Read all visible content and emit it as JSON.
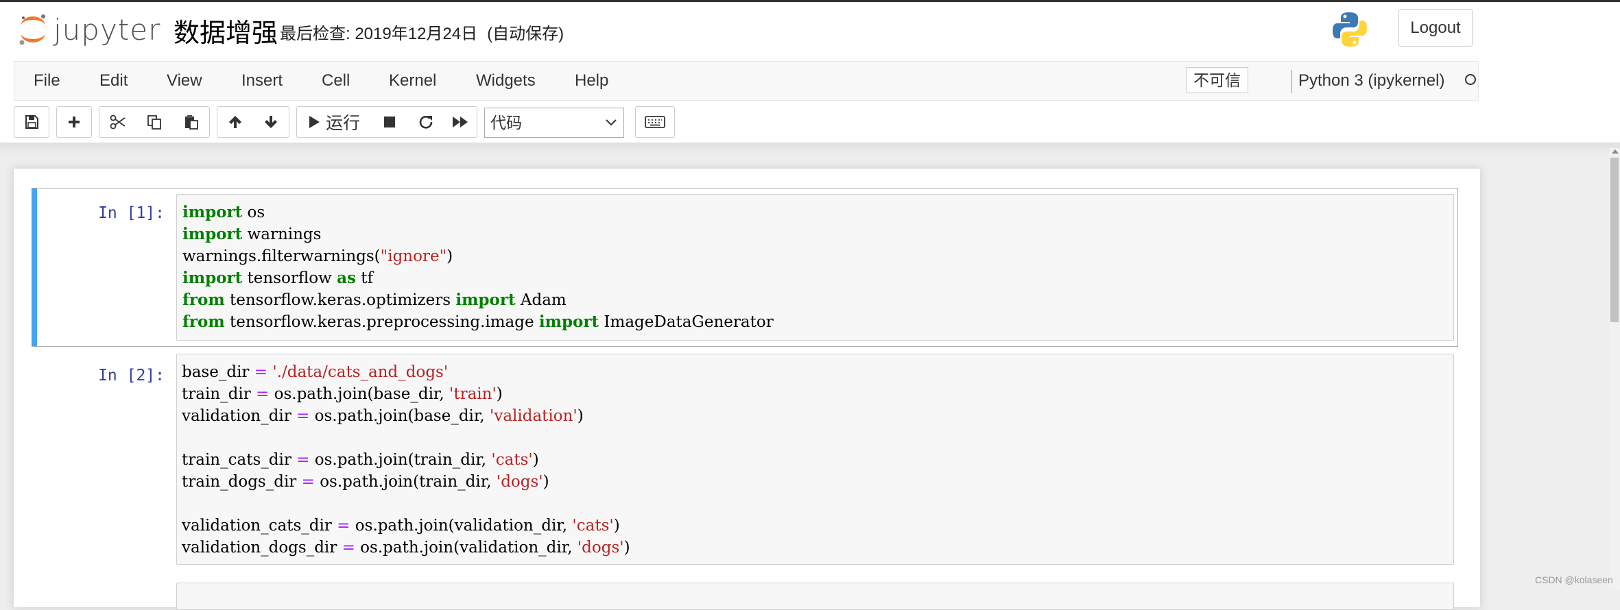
{
  "header": {
    "app_name": "jupyter",
    "notebook_name": "数据增强",
    "checkpoint": "最后检查: 2019年12月24日",
    "autosave": "(自动保存)",
    "logout_label": "Logout"
  },
  "menubar": {
    "items": [
      "File",
      "Edit",
      "View",
      "Insert",
      "Cell",
      "Kernel",
      "Widgets",
      "Help"
    ],
    "trust_label": "不可信",
    "kernel_name": "Python 3 (ipykernel)"
  },
  "toolbar": {
    "run_label": "运行",
    "cell_type": "代码"
  },
  "cells": [
    {
      "prompt": "In [1]:",
      "selected": true,
      "lines": [
        "import os",
        "import warnings",
        "warnings.filterwarnings(\"ignore\")",
        "import tensorflow as tf",
        "from tensorflow.keras.optimizers import Adam",
        "from tensorflow.keras.preprocessing.image import ImageDataGenerator"
      ]
    },
    {
      "prompt": "In [2]:",
      "selected": false,
      "lines": [
        "base_dir = './data/cats_and_dogs'",
        "train_dir = os.path.join(base_dir, 'train')",
        "validation_dir = os.path.join(base_dir, 'validation')",
        "",
        "train_cats_dir = os.path.join(train_dir, 'cats')",
        "train_dogs_dir = os.path.join(train_dir, 'dogs')",
        "",
        "validation_cats_dir = os.path.join(validation_dir, 'cats')",
        "validation_dogs_dir = os.path.join(validation_dir, 'dogs')"
      ]
    }
  ],
  "watermark": "CSDN @kolaseen",
  "colors": {
    "keyword": "#008000",
    "string": "#ba2121",
    "operator": "#aa22ff",
    "prompt": "#303f9f",
    "selected_cell_bar": "#42a5f5"
  },
  "icons": [
    "save-icon",
    "plus-icon",
    "cut-icon",
    "copy-icon",
    "paste-icon",
    "arrow-up-icon",
    "arrow-down-icon",
    "play-icon",
    "stop-icon",
    "restart-icon",
    "fast-forward-icon",
    "keyboard-icon",
    "kernel-idle-icon",
    "python-logo"
  ]
}
